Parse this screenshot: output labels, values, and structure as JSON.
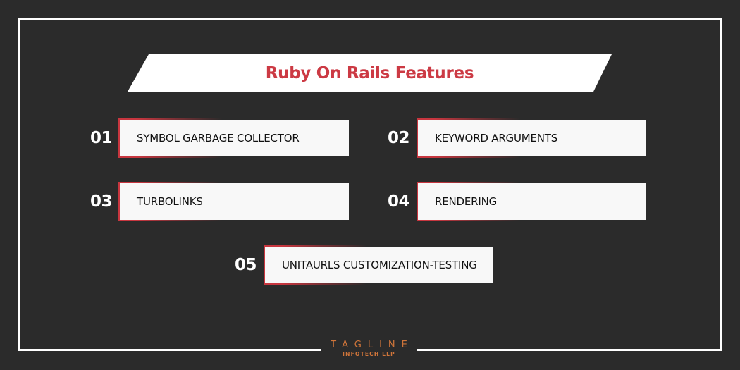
{
  "title": "Ruby On Rails Features",
  "features": [
    {
      "number": "01",
      "label": "SYMBOL GARBAGE COLLECTOR"
    },
    {
      "number": "02",
      "label": "KEYWORD ARGUMENTS"
    },
    {
      "number": "03",
      "label": "TURBOLINKS"
    },
    {
      "number": "04",
      "label": "RENDERING"
    },
    {
      "number": "05",
      "label": "UNITAURLS CUSTOMIZATION-TESTING"
    }
  ],
  "logo": {
    "name": "TAGLINE",
    "subtitle": "INFOTECH LLP"
  },
  "colors": {
    "background": "#2b2b2b",
    "accent": "#cc3a44",
    "logo": "#d0753a"
  }
}
